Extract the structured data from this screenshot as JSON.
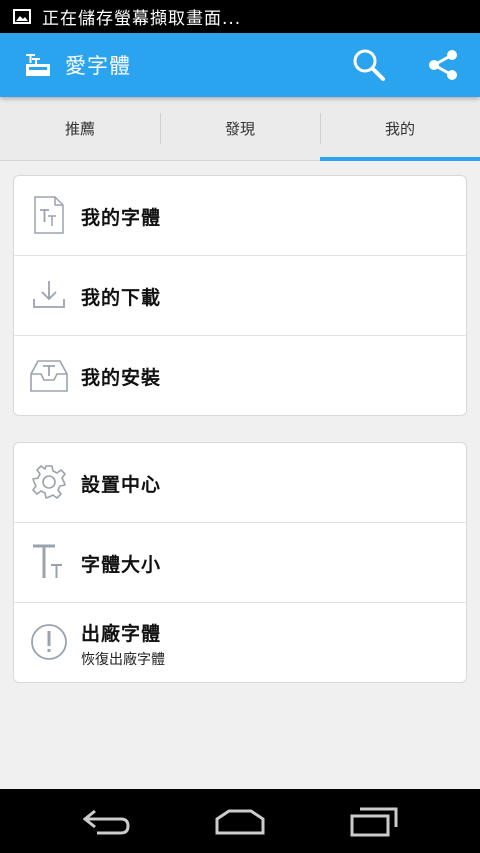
{
  "status_bar": {
    "notification_text": "正在儲存螢幕擷取畫面..."
  },
  "app_bar": {
    "title": "愛字體",
    "search_icon": "search-icon",
    "share_icon": "share-icon"
  },
  "tabs": [
    {
      "label": "推薦",
      "selected": false
    },
    {
      "label": "發現",
      "selected": false
    },
    {
      "label": "我的",
      "selected": true
    }
  ],
  "accent_color": "#2aa4ee",
  "card1": {
    "items": [
      {
        "label": "我的字體",
        "icon": "font-file-icon"
      },
      {
        "label": "我的下載",
        "icon": "download-icon"
      },
      {
        "label": "我的安裝",
        "icon": "install-tray-icon"
      }
    ]
  },
  "card2": {
    "items": [
      {
        "label": "設置中心",
        "icon": "gear-icon"
      },
      {
        "label": "字體大小",
        "icon": "font-size-icon"
      },
      {
        "label": "出廠字體",
        "sublabel": "恢復出廠字體",
        "icon": "alert-circle-icon"
      }
    ]
  },
  "nav_bar": {
    "back": "back-icon",
    "home": "home-icon",
    "recents": "recents-icon"
  }
}
